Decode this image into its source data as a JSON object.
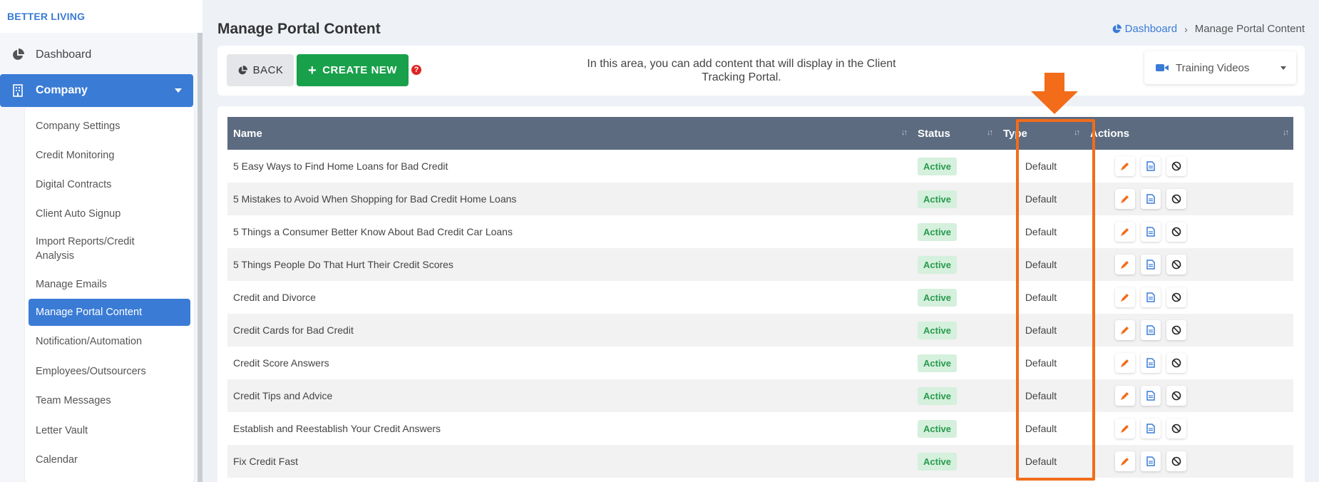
{
  "brand": "BETTER LIVING",
  "nav": {
    "dashboard_label": "Dashboard",
    "company_label": "Company",
    "submenu": [
      {
        "label": "Company Settings",
        "active": false
      },
      {
        "label": "Credit Monitoring",
        "active": false
      },
      {
        "label": "Digital Contracts",
        "active": false
      },
      {
        "label": "Client Auto Signup",
        "active": false
      },
      {
        "label": "Import Reports/Credit Analysis",
        "active": false
      },
      {
        "label": "Manage Emails",
        "active": false
      },
      {
        "label": "Manage Portal Content",
        "active": true
      },
      {
        "label": "Notification/Automation",
        "active": false
      },
      {
        "label": "Employees/Outsourcers",
        "active": false
      },
      {
        "label": "Team Messages",
        "active": false
      },
      {
        "label": "Letter Vault",
        "active": false
      },
      {
        "label": "Calendar",
        "active": false
      }
    ]
  },
  "page": {
    "title": "Manage Portal Content",
    "breadcrumb": {
      "home": "Dashboard",
      "current": "Manage Portal Content"
    }
  },
  "toolbar": {
    "back_label": "BACK",
    "create_label": "CREATE NEW",
    "help_glyph": "?",
    "info_text": "In this area, you can add content that will display in the Client Tracking Portal.",
    "select_value": "Training Videos"
  },
  "table": {
    "columns": [
      "Name",
      "Status",
      "Type",
      "Actions"
    ],
    "rows": [
      {
        "name": "5 Easy Ways to Find Home Loans for Bad Credit",
        "status": "Active",
        "type": "Default"
      },
      {
        "name": "5 Mistakes to Avoid When Shopping for Bad Credit Home Loans",
        "status": "Active",
        "type": "Default"
      },
      {
        "name": "5 Things a Consumer Better Know About Bad Credit Car Loans",
        "status": "Active",
        "type": "Default"
      },
      {
        "name": "5 Things People Do That Hurt Their Credit Scores",
        "status": "Active",
        "type": "Default"
      },
      {
        "name": "Credit and Divorce",
        "status": "Active",
        "type": "Default"
      },
      {
        "name": "Credit Cards for Bad Credit",
        "status": "Active",
        "type": "Default"
      },
      {
        "name": "Credit Score Answers",
        "status": "Active",
        "type": "Default"
      },
      {
        "name": "Credit Tips and Advice",
        "status": "Active",
        "type": "Default"
      },
      {
        "name": "Establish and Reestablish Your Credit Answers",
        "status": "Active",
        "type": "Default"
      },
      {
        "name": "Fix Credit Fast",
        "status": "Active",
        "type": "Default"
      }
    ]
  },
  "colors": {
    "primary": "#3a7bd5",
    "success": "#19a04b",
    "header": "#5c6b80",
    "annotation": "#f26c1a"
  }
}
